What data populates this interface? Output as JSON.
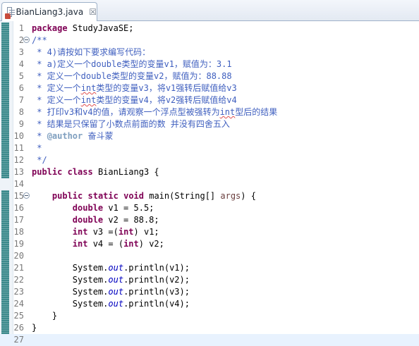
{
  "tab": {
    "title": "BianLiang3.java",
    "close": "☒"
  },
  "lines": [
    {
      "n": "1",
      "html": "<span class='kw'>package</span> StudyJavaSE;"
    },
    {
      "n": "2",
      "fold": true,
      "html": "<span class='cm'>/**</span>"
    },
    {
      "n": "3",
      "html": "<span class='cm'> * 4)请按如下要求编写代码：</span>"
    },
    {
      "n": "4",
      "html": "<span class='cm'> * a)定义一个double类型的变量v1，赋值为：3.1</span>"
    },
    {
      "n": "5",
      "html": "<span class='cm'> * 定义一个double类型的变量v2，赋值为：88.88</span>"
    },
    {
      "n": "6",
      "html": "<span class='cm'> * 定义一个<span class='squig'>int</span>类型的变量v3，将v1强转后赋值给v3</span>"
    },
    {
      "n": "7",
      "html": "<span class='cm'> * 定义一个<span class='squig'>int</span>类型的变量v4，将v2强转后赋值给v4</span>"
    },
    {
      "n": "8",
      "html": "<span class='cm'> * 打印v3和v4的值，请观察一个浮点型被强转为<span class='squig'>int</span>型后的结果</span>"
    },
    {
      "n": "9",
      "html": "<span class='cm'> * 结果是只保留了小数点前面的数 并没有四舍五入</span>"
    },
    {
      "n": "10",
      "html": "<span class='cm'> * </span><span class='tag'>@author</span><span class='cm'> 奋斗蒙</span>"
    },
    {
      "n": "11",
      "html": "<span class='cm'> *</span>"
    },
    {
      "n": "12",
      "html": "<span class='cm'> */</span>"
    },
    {
      "n": "13",
      "html": "<span class='kw'>public</span> <span class='kw'>class</span> BianLiang3 {"
    },
    {
      "n": "14",
      "html": ""
    },
    {
      "n": "15",
      "fold": true,
      "html": "    <span class='kw'>public</span> <span class='kw'>static</span> <span class='kw'>void</span> main(String[] <span class='param'>args</span>) {"
    },
    {
      "n": "16",
      "html": "        <span class='kw'>double</span> v1 = 5.5;"
    },
    {
      "n": "17",
      "html": "        <span class='kw'>double</span> v2 = 88.8;"
    },
    {
      "n": "18",
      "html": "        <span class='kw'>int</span> v3 =(<span class='kw'>int</span>) v1;"
    },
    {
      "n": "19",
      "html": "        <span class='kw'>int</span> v4 = (<span class='kw'>int</span>) v2;"
    },
    {
      "n": "20",
      "html": ""
    },
    {
      "n": "21",
      "html": "        System.<span class='fld'>out</span>.println(v1);"
    },
    {
      "n": "22",
      "html": "        System.<span class='fld'>out</span>.println(v2);"
    },
    {
      "n": "23",
      "html": "        System.<span class='fld'>out</span>.println(v3);"
    },
    {
      "n": "24",
      "html": "        System.<span class='fld'>out</span>.println(v4);"
    },
    {
      "n": "25",
      "html": "    }"
    },
    {
      "n": "26",
      "html": "}"
    },
    {
      "n": "27",
      "html": "",
      "current": true
    }
  ]
}
